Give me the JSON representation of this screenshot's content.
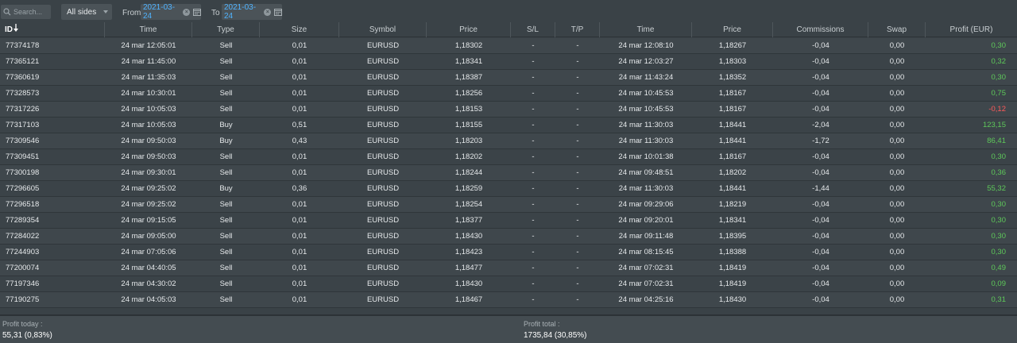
{
  "toolbar": {
    "search_placeholder": "Search...",
    "sides_selected": "All sides",
    "from_label": "From",
    "from_value": "2021-03-24",
    "to_label": "To",
    "to_value": "2021-03-24"
  },
  "columns": [
    "ID",
    "Time",
    "Type",
    "Size",
    "Symbol",
    "Price",
    "S/L",
    "T/P",
    "Time",
    "Price",
    "Commissions",
    "Swap",
    "Profit (EUR)"
  ],
  "rows": [
    [
      "77374178",
      "24 mar 12:05:01",
      "Sell",
      "0,01",
      "EURUSD",
      "1,18302",
      "-",
      "-",
      "24 mar 12:08:10",
      "1,18267",
      "-0,04",
      "0,00",
      "0,30"
    ],
    [
      "77365121",
      "24 mar 11:45:00",
      "Sell",
      "0,01",
      "EURUSD",
      "1,18341",
      "-",
      "-",
      "24 mar 12:03:27",
      "1,18303",
      "-0,04",
      "0,00",
      "0,32"
    ],
    [
      "77360619",
      "24 mar 11:35:03",
      "Sell",
      "0,01",
      "EURUSD",
      "1,18387",
      "-",
      "-",
      "24 mar 11:43:24",
      "1,18352",
      "-0,04",
      "0,00",
      "0,30"
    ],
    [
      "77328573",
      "24 mar 10:30:01",
      "Sell",
      "0,01",
      "EURUSD",
      "1,18256",
      "-",
      "-",
      "24 mar 10:45:53",
      "1,18167",
      "-0,04",
      "0,00",
      "0,75"
    ],
    [
      "77317226",
      "24 mar 10:05:03",
      "Sell",
      "0,01",
      "EURUSD",
      "1,18153",
      "-",
      "-",
      "24 mar 10:45:53",
      "1,18167",
      "-0,04",
      "0,00",
      "-0,12"
    ],
    [
      "77317103",
      "24 mar 10:05:03",
      "Buy",
      "0,51",
      "EURUSD",
      "1,18155",
      "-",
      "-",
      "24 mar 11:30:03",
      "1,18441",
      "-2,04",
      "0,00",
      "123,15"
    ],
    [
      "77309546",
      "24 mar 09:50:03",
      "Buy",
      "0,43",
      "EURUSD",
      "1,18203",
      "-",
      "-",
      "24 mar 11:30:03",
      "1,18441",
      "-1,72",
      "0,00",
      "86,41"
    ],
    [
      "77309451",
      "24 mar 09:50:03",
      "Sell",
      "0,01",
      "EURUSD",
      "1,18202",
      "-",
      "-",
      "24 mar 10:01:38",
      "1,18167",
      "-0,04",
      "0,00",
      "0,30"
    ],
    [
      "77300198",
      "24 mar 09:30:01",
      "Sell",
      "0,01",
      "EURUSD",
      "1,18244",
      "-",
      "-",
      "24 mar 09:48:51",
      "1,18202",
      "-0,04",
      "0,00",
      "0,36"
    ],
    [
      "77296605",
      "24 mar 09:25:02",
      "Buy",
      "0,36",
      "EURUSD",
      "1,18259",
      "-",
      "-",
      "24 mar 11:30:03",
      "1,18441",
      "-1,44",
      "0,00",
      "55,32"
    ],
    [
      "77296518",
      "24 mar 09:25:02",
      "Sell",
      "0,01",
      "EURUSD",
      "1,18254",
      "-",
      "-",
      "24 mar 09:29:06",
      "1,18219",
      "-0,04",
      "0,00",
      "0,30"
    ],
    [
      "77289354",
      "24 mar 09:15:05",
      "Sell",
      "0,01",
      "EURUSD",
      "1,18377",
      "-",
      "-",
      "24 mar 09:20:01",
      "1,18341",
      "-0,04",
      "0,00",
      "0,30"
    ],
    [
      "77284022",
      "24 mar 09:05:00",
      "Sell",
      "0,01",
      "EURUSD",
      "1,18430",
      "-",
      "-",
      "24 mar 09:11:48",
      "1,18395",
      "-0,04",
      "0,00",
      "0,30"
    ],
    [
      "77244903",
      "24 mar 07:05:06",
      "Sell",
      "0,01",
      "EURUSD",
      "1,18423",
      "-",
      "-",
      "24 mar 08:15:45",
      "1,18388",
      "-0,04",
      "0,00",
      "0,30"
    ],
    [
      "77200074",
      "24 mar 04:40:05",
      "Sell",
      "0,01",
      "EURUSD",
      "1,18477",
      "-",
      "-",
      "24 mar 07:02:31",
      "1,18419",
      "-0,04",
      "0,00",
      "0,49"
    ],
    [
      "77197346",
      "24 mar 04:30:02",
      "Sell",
      "0,01",
      "EURUSD",
      "1,18430",
      "-",
      "-",
      "24 mar 07:02:31",
      "1,18419",
      "-0,04",
      "0,00",
      "0,09"
    ],
    [
      "77190275",
      "24 mar 04:05:03",
      "Sell",
      "0,01",
      "EURUSD",
      "1,18467",
      "-",
      "-",
      "24 mar 04:25:16",
      "1,18430",
      "-0,04",
      "0,00",
      "0,31"
    ]
  ],
  "footer": {
    "today_label": "Profit today :",
    "today_value": "55,31 (0,83%)",
    "total_label": "Profit total :",
    "total_value": "1735,84 (30,85%)"
  },
  "colors": {
    "positive": "#5ec95a",
    "negative": "#ff5a5a",
    "date_text": "#4fb3ff"
  },
  "icons": {
    "search": "search-icon",
    "sort": "sort-desc-icon",
    "clear": "clear-icon",
    "calendar": "calendar-icon"
  }
}
